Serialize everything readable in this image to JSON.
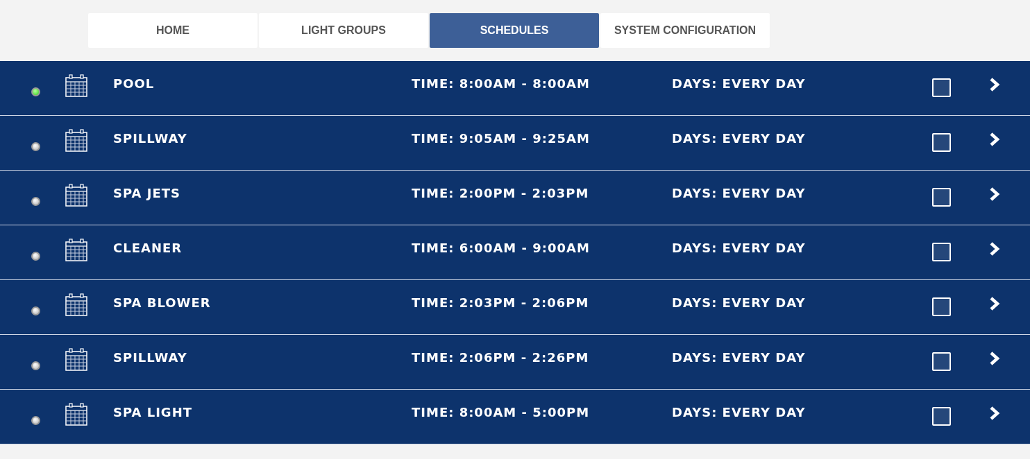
{
  "tabs": [
    {
      "label": "HOME",
      "selected": false
    },
    {
      "label": "LIGHT GROUPS",
      "selected": false
    },
    {
      "label": "SCHEDULES",
      "selected": true
    },
    {
      "label": "SYSTEM CONFIGURATION",
      "selected": false
    }
  ],
  "schedules": [
    {
      "name": "POOL",
      "time": "TIME: 8:00AM - 8:00AM",
      "days": "DAYS: EVERY DAY",
      "active": true,
      "checked": false
    },
    {
      "name": "SPILLWAY",
      "time": "TIME: 9:05AM - 9:25AM",
      "days": "DAYS: EVERY DAY",
      "active": false,
      "checked": false
    },
    {
      "name": "SPA JETS",
      "time": "TIME: 2:00PM - 2:03PM",
      "days": "DAYS: EVERY DAY",
      "active": false,
      "checked": false
    },
    {
      "name": "CLEANER",
      "time": "TIME: 6:00AM - 9:00AM",
      "days": "DAYS: EVERY DAY",
      "active": false,
      "checked": false
    },
    {
      "name": "SPA BLOWER",
      "time": "TIME: 2:03PM - 2:06PM",
      "days": "DAYS: EVERY DAY",
      "active": false,
      "checked": false
    },
    {
      "name": "SPILLWAY",
      "time": "TIME: 2:06PM - 2:26PM",
      "days": "DAYS: EVERY DAY",
      "active": false,
      "checked": false
    },
    {
      "name": "SPA LIGHT",
      "time": "TIME: 8:00AM - 5:00PM",
      "days": "DAYS: EVERY DAY",
      "active": false,
      "checked": false
    }
  ]
}
